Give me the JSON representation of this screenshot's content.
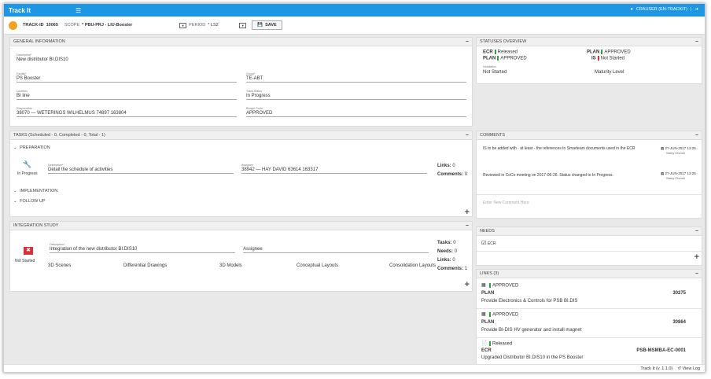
{
  "app": {
    "title": "Track It",
    "user": "CRAUSER (EN-TRACKIT)"
  },
  "toolbar": {
    "trackid_label": "TRACK-ID",
    "trackid_value": "10065",
    "scope_label": "SCOPE",
    "scope_value": "* PBU-PRJ - LIU-Booster",
    "period_label": "PERIOD",
    "period_value": "* LS2",
    "save_label": "SAVE"
  },
  "general": {
    "title": "GENERAL INFORMATION",
    "description_label": "Description*",
    "description": "New distributor BI.DIS10",
    "facility_label": "Facility*",
    "facility": "PS Booster",
    "owner_label": "Group*",
    "owner": "TE-ABT",
    "location_label": "Location",
    "location": "BI line",
    "status_label": "Track Status",
    "status": "In Progress",
    "responsible_label": "Responsible",
    "responsible": "38070  —  WETERINGS WILHELMUS 74897 163804",
    "budget_label": "Budget Code",
    "budget": "APPROVED"
  },
  "statuses": {
    "title": "STATUSES OVERVIEW",
    "ecr_label": "ECR",
    "ecr_value": "Released",
    "plan_label": "PLAN",
    "plan_value": "APPROVED",
    "plan2_label": "PLAN",
    "plan2_value": "APPROVED",
    "is_label": "IS",
    "is_value": "Not Started",
    "install_label": "Installation",
    "install_value": "Not Started",
    "maturity_label": "Maturity Level"
  },
  "tasks": {
    "title": "TASKS (Scheduled - 0, Completed - 0, Total - 1)",
    "prep": "PREPARATION",
    "task_status": "In Progress",
    "desc_label": "Description*",
    "desc": "Detail the schedule of activities",
    "assignee_label": "Assignee",
    "assignee": "38942  —  HAY DAVID 63614 163317",
    "links_label": "Links:",
    "links_count": "0",
    "comments_label": "Comments:",
    "comments_count": "0",
    "impl": "IMPLEMENTATION",
    "follow": "FOLLOW UP"
  },
  "integration": {
    "title": "INTEGRATION STUDY",
    "status": "Not Started",
    "desc_label": "Description*",
    "desc": "Integration of the new distributor BI.DIS10",
    "assignee_label": "Assignee",
    "col1": "3D Scenes",
    "col2": "Differential Drawings",
    "col3": "3D Models",
    "col4": "Conceptual Layouts",
    "col5": "Consolidation Layouts",
    "tasks_label": "Tasks:",
    "tasks_count": "0",
    "needs_label": "Needs:",
    "needs_count": "0",
    "links_label": "Links:",
    "links_count": "0",
    "comments_label": "Comments:",
    "comments_count": "1"
  },
  "comments": {
    "title": "COMMENTS",
    "items": [
      {
        "text": "IS to be added with - at least - the references to Smarteam documents used in the ECR",
        "date": "27-JUN-2017 13:25",
        "author": "Samy Chemli"
      },
      {
        "text": "Reviewed in CoCo meeting on 2017-06-26. Status changed to In Progress.",
        "date": "27-JUN-2017 13:25",
        "author": "Samy Chemli"
      }
    ],
    "placeholder": "Enter New Comment Here"
  },
  "needs": {
    "title": "NEEDS",
    "item": "ECR"
  },
  "links": {
    "title": "LINKS (3)",
    "items": [
      {
        "status": "APPROVED",
        "type": "PLAN",
        "id": "30275",
        "desc": "Provide Electronics & Controls for PSB BI.DIS"
      },
      {
        "status": "APPROVED",
        "type": "PLAN",
        "id": "30864",
        "desc": "Provide BI-DIS HV generator and install magnet"
      },
      {
        "status": "Released",
        "type": "ECR",
        "id": "PSB-MSMBA-EC-0001",
        "desc": "Upgraded Distributor BI.DIS10 in the PS Booster"
      }
    ]
  },
  "footer": {
    "version": "Track It (v. 1.1.0)",
    "viewlog": "View Log"
  },
  "colors": {
    "accent": "#1e96e6",
    "green": "#2e9e3e",
    "red": "#d9303a",
    "orange": "#f2a21c"
  }
}
